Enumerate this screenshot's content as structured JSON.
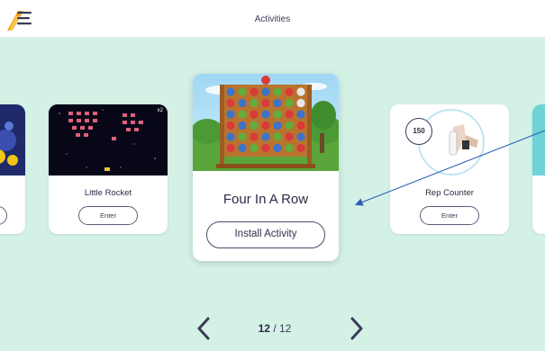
{
  "header": {
    "title": "Activities",
    "menu_icon": "hamburger-menu-icon",
    "accent_color": "#f4a21c"
  },
  "carousel": {
    "cards": [
      {
        "title": "Little Rocket",
        "action": "Enter",
        "badge": "x2",
        "thumb_icon": "space-invaders-thumbnail"
      },
      {
        "title": "Four In A Row",
        "action": "Install Activity",
        "thumb_icon": "connect-four-board-thumbnail"
      },
      {
        "title": "Rep Counter",
        "action": "Enter",
        "badge": "150",
        "thumb_icon": "hand-grip-thumbnail"
      }
    ]
  },
  "pagination": {
    "current": "12",
    "separator": " / ",
    "total": "12",
    "prev_icon": "chevron-left-icon",
    "next_icon": "chevron-right-icon"
  },
  "colors": {
    "background": "#d4f1e6",
    "text": "#2b2b48",
    "annotation_arrow": "#2d5fb3"
  }
}
